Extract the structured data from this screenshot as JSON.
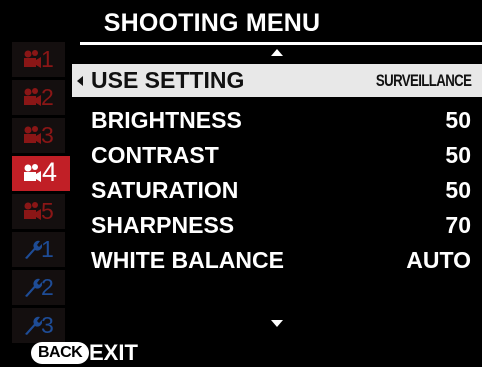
{
  "title": "SHOOTING MENU",
  "sidebar": {
    "tabs": [
      {
        "icon": "movie-camera-icon",
        "number": "1",
        "active": false
      },
      {
        "icon": "movie-camera-icon",
        "number": "2",
        "active": false
      },
      {
        "icon": "movie-camera-icon",
        "number": "3",
        "active": false
      },
      {
        "icon": "movie-camera-icon",
        "number": "4",
        "active": true
      },
      {
        "icon": "movie-camera-icon",
        "number": "5",
        "active": false
      },
      {
        "icon": "wrench-icon",
        "number": "1",
        "active": false
      },
      {
        "icon": "wrench-icon",
        "number": "2",
        "active": false
      },
      {
        "icon": "wrench-icon",
        "number": "3",
        "active": false
      }
    ]
  },
  "menu": {
    "items": [
      {
        "label": "USE SETTING",
        "value": "SURVEILLANCE",
        "selected": true
      },
      {
        "label": "BRIGHTNESS",
        "value": "50",
        "selected": false
      },
      {
        "label": "CONTRAST",
        "value": "50",
        "selected": false
      },
      {
        "label": "SATURATION",
        "value": "50",
        "selected": false
      },
      {
        "label": "SHARPNESS",
        "value": "70",
        "selected": false
      },
      {
        "label": "WHITE BALANCE",
        "value": "AUTO",
        "selected": false
      }
    ]
  },
  "footer": {
    "back_label": "BACK",
    "exit_label": "EXIT"
  },
  "colors": {
    "accent_red": "#c11f26",
    "camera_tab": "#8a1616",
    "wrench_tab": "#1e4c96",
    "selected_row": "#e8e8e8"
  }
}
